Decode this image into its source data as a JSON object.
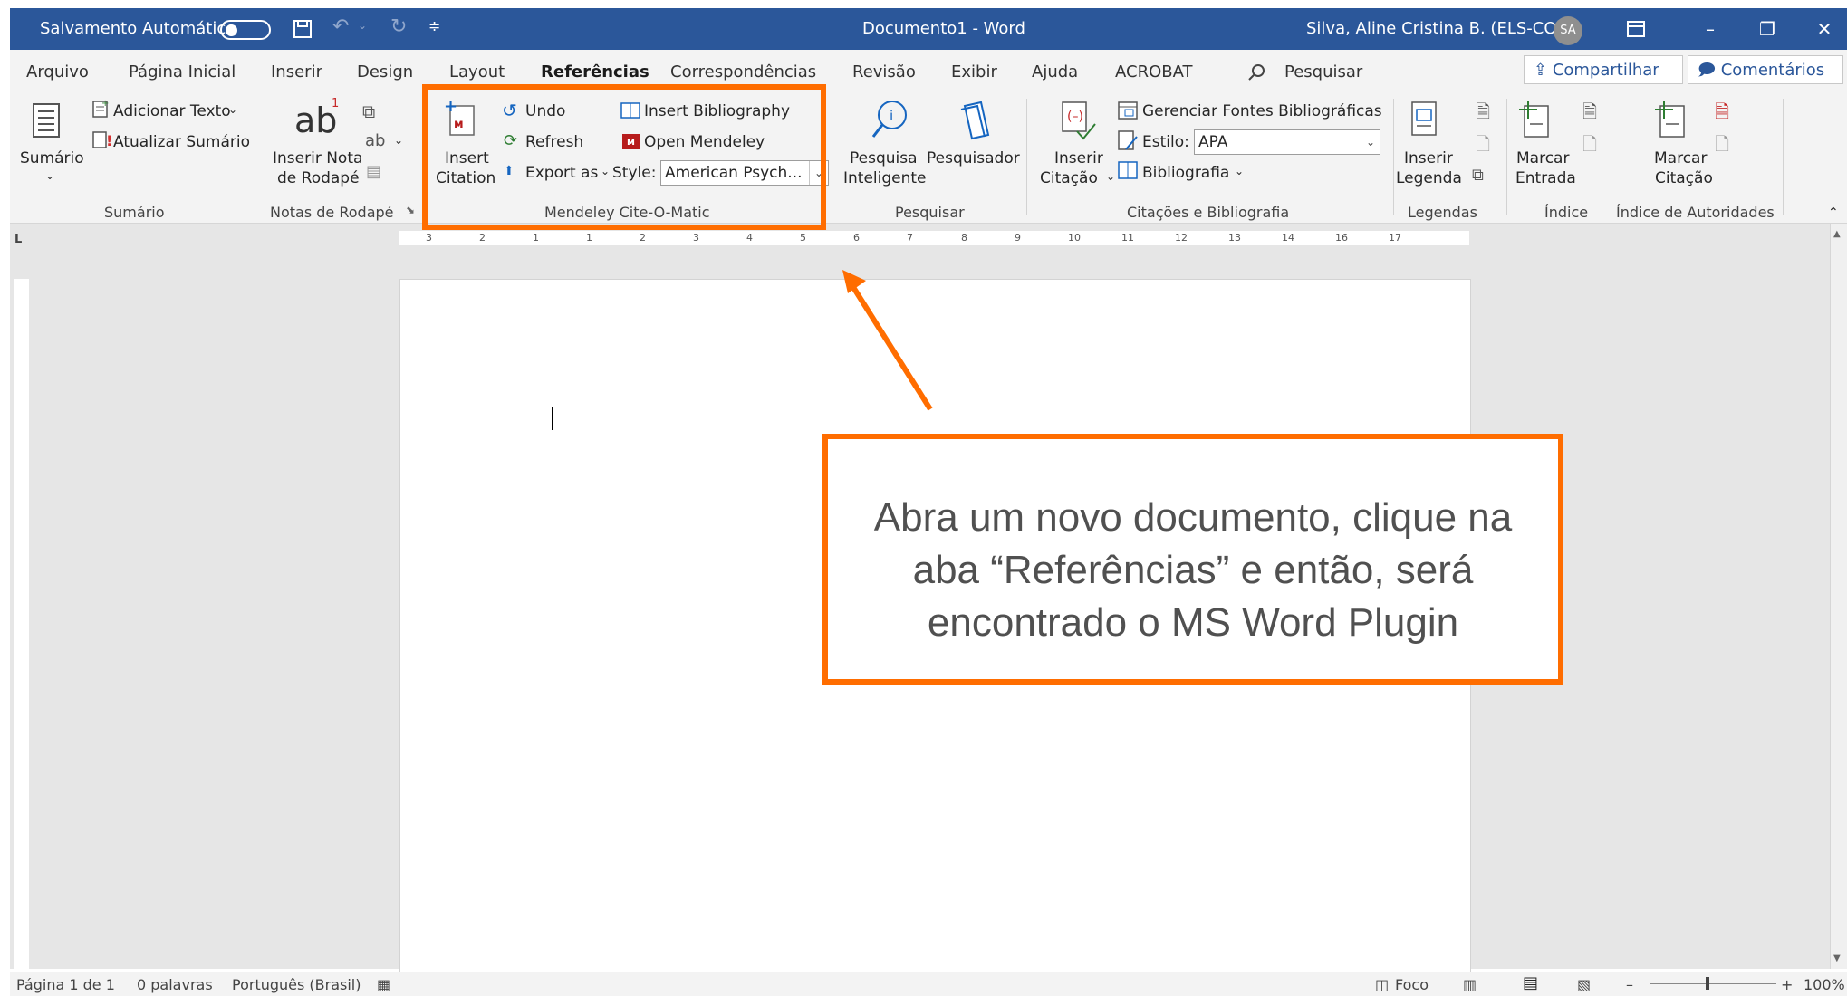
{
  "titlebar": {
    "autosave_label": "Salvamento Automático",
    "doc_title": "Documento1  -  Word",
    "user_name": "Silva, Aline Cristina B. (ELS-CON)",
    "user_initials": "SA"
  },
  "tabs": [
    {
      "label": "Arquivo"
    },
    {
      "label": "Página Inicial"
    },
    {
      "label": "Inserir"
    },
    {
      "label": "Design"
    },
    {
      "label": "Layout"
    },
    {
      "label": "Referências"
    },
    {
      "label": "Correspondências"
    },
    {
      "label": "Revisão"
    },
    {
      "label": "Exibir"
    },
    {
      "label": "Ajuda"
    },
    {
      "label": "ACROBAT"
    }
  ],
  "search_label": "Pesquisar",
  "share_label": "Compartilhar",
  "comments_label": "Comentários",
  "ribbon": {
    "sumario": {
      "main": "Sumário",
      "add_text": "Adicionar Texto",
      "update": "Atualizar Sumário",
      "group": "Sumário"
    },
    "footnotes": {
      "insert_line1": "Inserir Nota",
      "insert_line2": "de Rodapé",
      "group": "Notas de Rodapé"
    },
    "mendeley": {
      "insert_line1": "Insert",
      "insert_line2": "Citation",
      "undo": "Undo",
      "refresh": "Refresh",
      "export": "Export as",
      "insert_bibliography": "Insert Bibliography",
      "open_mendeley": "Open Mendeley",
      "style_label": "Style:",
      "style_value": "American Psych...",
      "group": "Mendeley Cite-O-Matic"
    },
    "pesquisar": {
      "smart_line1": "Pesquisa",
      "smart_line2": "Inteligente",
      "researcher": "Pesquisador",
      "group": "Pesquisar"
    },
    "citacoes": {
      "insert_line1": "Inserir",
      "insert_line2": "Citação",
      "manage_sources": "Gerenciar Fontes Bibliográficas",
      "style_label": "Estilo:",
      "style_value": "APA",
      "bibliography": "Bibliografia",
      "group": "Citações e Bibliografia"
    },
    "legendas": {
      "insert_line1": "Inserir",
      "insert_line2": "Legenda",
      "group": "Legendas"
    },
    "indice": {
      "mark_line1": "Marcar",
      "mark_line2": "Entrada",
      "group": "Índice"
    },
    "autoridades": {
      "mark_line1": "Marcar",
      "mark_line2": "Citação",
      "group": "Índice de Autoridades"
    }
  },
  "ruler_ticks": [
    "3",
    "2",
    "1",
    "1",
    "2",
    "3",
    "4",
    "5",
    "6",
    "7",
    "8",
    "9",
    "10",
    "11",
    "12",
    "13",
    "14",
    "16",
    "17"
  ],
  "statusbar": {
    "page": "Página 1 de 1",
    "words": "0 palavras",
    "language": "Português (Brasil)",
    "focus": "Foco",
    "zoom": "100%"
  },
  "callout": {
    "line1": "Abra um novo documento, clique na",
    "line2": "aba “Referências” e então, será",
    "line3": "encontrado o MS Word Plugin"
  },
  "colors": {
    "titlebar": "#2b579a",
    "annotation": "#ff6d00"
  }
}
